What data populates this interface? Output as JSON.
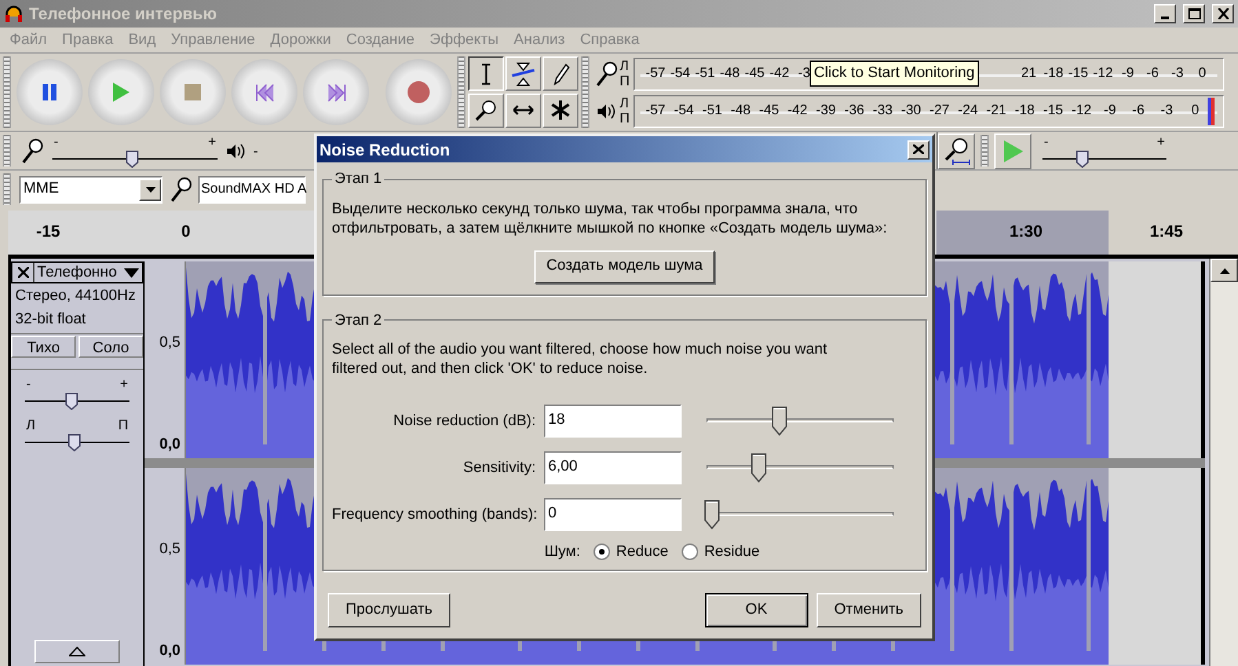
{
  "window": {
    "title": "Телефонное интервью"
  },
  "menu": [
    {
      "label": "Файл"
    },
    {
      "label": "Правка"
    },
    {
      "label": "Вид"
    },
    {
      "label": "Управление"
    },
    {
      "label": "Дорожки"
    },
    {
      "label": "Создание"
    },
    {
      "label": "Эффекты"
    },
    {
      "label": "Анализ"
    },
    {
      "label": "Справка"
    }
  ],
  "meters": {
    "input": {
      "channel_labels": [
        "Л",
        "П"
      ],
      "ticks_before": [
        "-57",
        "-54",
        "-51",
        "-48",
        "-45",
        "-42",
        "-3"
      ],
      "tooltip": "Click to Start Monitoring",
      "ticks_after": [
        "21",
        "-18",
        "-15",
        "-12",
        "-9",
        "-6",
        "-3",
        "0"
      ]
    },
    "output": {
      "channel_labels": [
        "Л",
        "П"
      ],
      "ticks": [
        "-57",
        "-54",
        "-51",
        "-48",
        "-45",
        "-42",
        "-39",
        "-36",
        "-33",
        "-30",
        "-27",
        "-24",
        "-21",
        "-18",
        "-15",
        "-12",
        "-9",
        "-6",
        "-3",
        "0"
      ]
    }
  },
  "mixer": {
    "input_volume": {
      "min_label": "-",
      "max_label": "+",
      "level": 0.48
    },
    "output_volume": {
      "min_label": "-"
    }
  },
  "playback_speed": {
    "min_label": "-",
    "max_label": "+",
    "level": 0.32
  },
  "device": {
    "host": "MME",
    "input_device": "SoundMAX HD A"
  },
  "ruler": {
    "labels": [
      "-15",
      "0",
      "1:30",
      "1:45"
    ]
  },
  "track": {
    "name": "Телефонно",
    "info": [
      "Стерео, 44100Hz",
      "32-bit float"
    ],
    "buttons": [
      {
        "label": "Тихо"
      },
      {
        "label": "Соло"
      }
    ],
    "gain": {
      "min_label": "-",
      "max_label": "+",
      "level": 0.45
    },
    "pan": {
      "min_label": "Л",
      "max_label": "П",
      "level": 0.48
    },
    "channels": [
      {
        "labels": [
          "0,5",
          "0,0"
        ]
      },
      {
        "labels": [
          "0,5",
          "0,0"
        ]
      }
    ]
  },
  "dialog": {
    "title": "Noise Reduction",
    "step1": {
      "title": "Этап 1",
      "text": "Выделите несколько секунд только шума, так чтобы программа знала, что отфильтровать, а затем щёлкните мышкой по кнопке «Создать модель шума»:",
      "button": "Создать модель шума"
    },
    "step2": {
      "title": "Этап 2",
      "text": "Select all of the audio you want filtered, choose how much noise you want filtered out, and then click 'OK' to reduce noise.",
      "params": [
        {
          "label": "Noise reduction (dB):",
          "value": "18",
          "level": 0.39
        },
        {
          "label": "Sensitivity:",
          "value": "6,00",
          "level": 0.28
        },
        {
          "label": "Frequency smoothing (bands):",
          "value": "0",
          "level": 0.03
        }
      ],
      "noise": {
        "label": "Шум:",
        "options": [
          {
            "label": "Reduce",
            "selected": true
          },
          {
            "label": "Residue",
            "selected": false
          }
        ]
      }
    },
    "buttons": [
      {
        "label": "Прослушать",
        "default": false
      },
      {
        "label": "OK",
        "default": true
      },
      {
        "label": "Отменить",
        "default": false
      }
    ]
  }
}
